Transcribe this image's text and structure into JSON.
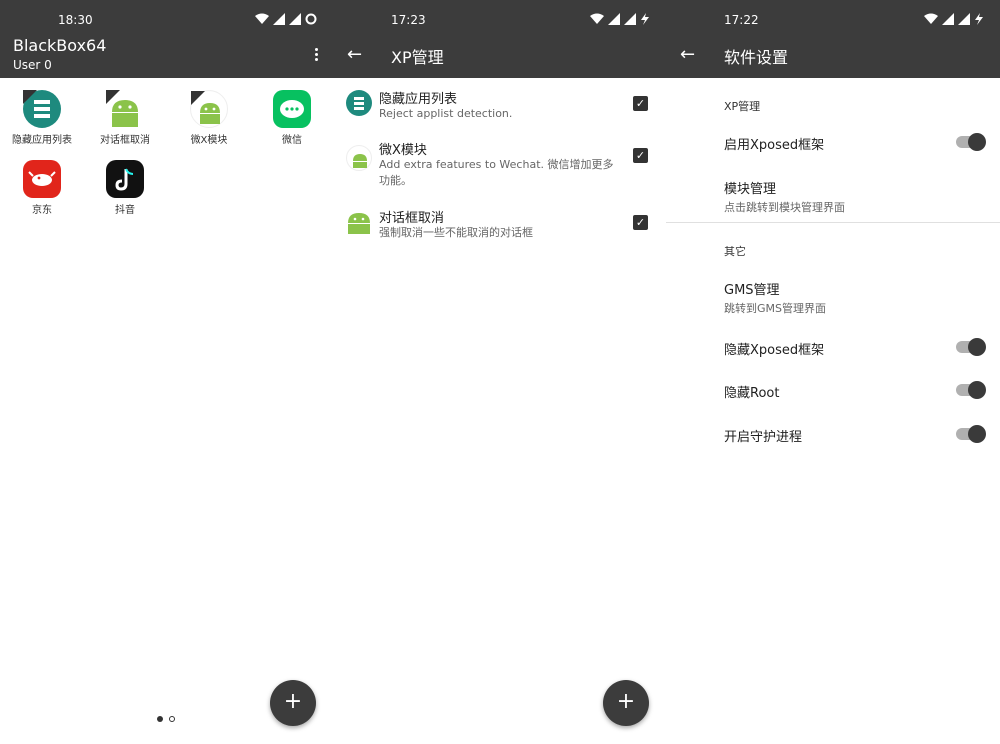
{
  "screen1": {
    "time": "18:30",
    "title": "BlackBox64",
    "subtitle": "User 0",
    "apps": [
      {
        "label": "隐藏应用列表",
        "icon": "list-icon",
        "color": "#1e8a7e"
      },
      {
        "label": "对话框取消",
        "icon": "android-icon",
        "color": "#8bc34a"
      },
      {
        "label": "微X模块",
        "icon": "android-icon",
        "color": "#8bc34a"
      },
      {
        "label": "微信",
        "icon": "wechat-icon",
        "color": "#07c160"
      },
      {
        "label": "京东",
        "icon": "jd-icon",
        "color": "#e1251b"
      },
      {
        "label": "抖音",
        "icon": "tiktok-icon",
        "color": "#111111"
      }
    ],
    "fab": "+"
  },
  "screen2": {
    "time": "17:23",
    "title": "XP管理",
    "modules": [
      {
        "title": "隐藏应用列表",
        "desc": "Reject applist detection.",
        "checked": true
      },
      {
        "title": "微X模块",
        "desc": "Add extra features to Wechat. 微信增加更多功能。",
        "checked": true
      },
      {
        "title": "对话框取消",
        "desc": "强制取消一些不能取消的对话框",
        "checked": true
      }
    ],
    "fab": "+"
  },
  "screen3": {
    "time": "17:22",
    "title": "软件设置",
    "section1": "XP管理",
    "enable_xposed": "启用Xposed框架",
    "module_manage": "模块管理",
    "module_manage_desc": "点击跳转到模块管理界面",
    "section2": "其它",
    "gms": "GMS管理",
    "gms_desc": "跳转到GMS管理界面",
    "hide_xposed": "隐藏Xposed框架",
    "hide_root": "隐藏Root",
    "daemon": "开启守护进程"
  },
  "colors": {
    "bar": "#3c3c3c",
    "accent": "#3a3a3a"
  }
}
